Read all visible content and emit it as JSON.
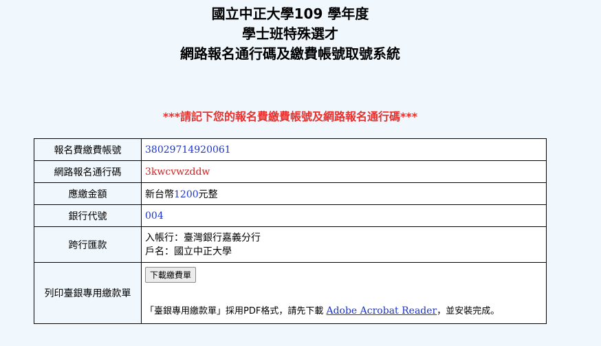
{
  "header": {
    "line1": "國立中正大學109 學年度",
    "line2": "學士班特殊選才",
    "line3": "網路報名通行碼及繳費帳號取號系統"
  },
  "notice": "***請記下您的報名費繳費帳號及網路報名通行碼***",
  "rows": {
    "account": {
      "label": "報名費繳費帳號",
      "value": "38029714920061"
    },
    "passcode": {
      "label": "網路報名通行碼",
      "value": "3kwcvwzddw"
    },
    "amount": {
      "label": "應繳金額",
      "prefix": "新台幣",
      "number": "1200",
      "suffix": "元整"
    },
    "bank_code": {
      "label": "銀行代號",
      "value": "004"
    },
    "interbank": {
      "label": "跨行匯款",
      "bank_line": "入帳行：臺灣銀行嘉義分行",
      "name_line": "戶名：國立中正大學"
    },
    "print": {
      "label": "列印臺銀專用繳款單",
      "button_label": "下載繳費單",
      "note_prefix": "「臺銀專用繳款單」採用PDF格式，請先下載 ",
      "link_text": "Adobe Acrobat Reader",
      "note_suffix": "，並安裝完成。"
    }
  }
}
